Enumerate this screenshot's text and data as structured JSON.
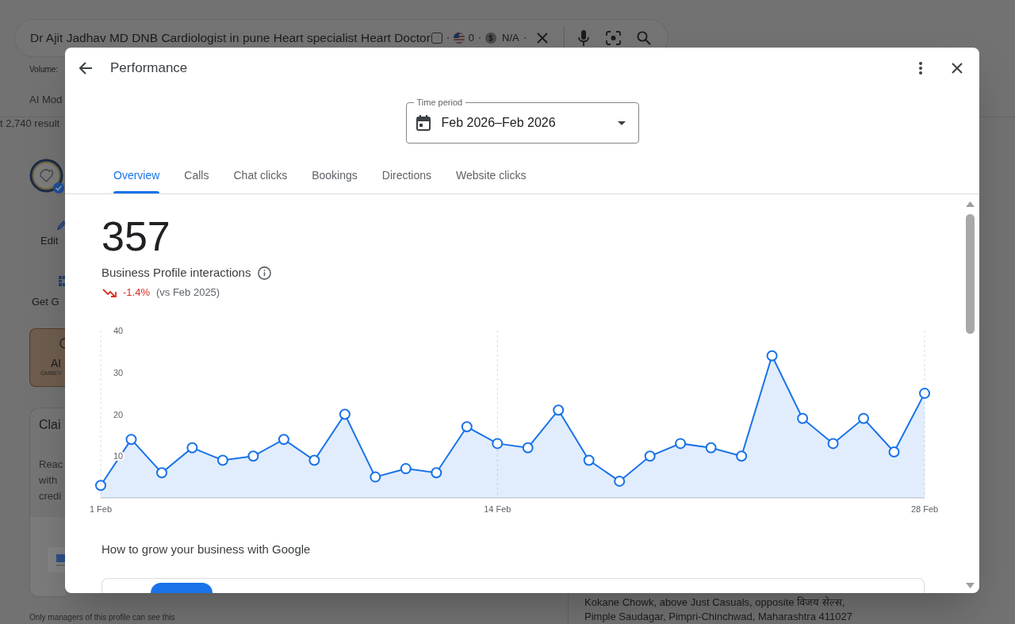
{
  "background_page": {
    "search_bar": {
      "query": "Dr Ajit Jadhav MD DNB Cardiologist in pune Heart specialist Heart Doctor",
      "checkbox": {
        "checked": false
      },
      "flag_count": "0",
      "cpc": "N/A"
    },
    "volume_label": "Volume:",
    "mode_tab": "AI Mod",
    "results_count": "t 2,740 result",
    "actions": [
      {
        "label": "Edit",
        "kind": "edit"
      },
      {
        "label": "Get G",
        "kind": "grid"
      }
    ],
    "promo_card": {
      "title": "AI",
      "subtitle": "GMBEV"
    },
    "claim_card": {
      "title": "Clai",
      "lines": [
        "Reac",
        "with",
        "credi"
      ]
    },
    "managers_note": "Only managers of this profile can see this",
    "address_lines": [
      "Kokane Chowk, above Just Casuals, opposite विजय सेल्स,",
      "Pimple Saudagar, Pimpri-Chinchwad, Maharashtra 411027"
    ]
  },
  "dialog": {
    "title": "Performance",
    "time_period": {
      "label": "Time period",
      "value": "Feb 2026–Feb 2026"
    },
    "tabs": [
      {
        "label": "Overview",
        "selected": true
      },
      {
        "label": "Calls",
        "selected": false
      },
      {
        "label": "Chat clicks",
        "selected": false
      },
      {
        "label": "Bookings",
        "selected": false
      },
      {
        "label": "Directions",
        "selected": false
      },
      {
        "label": "Website clicks",
        "selected": false
      }
    ],
    "total": "357",
    "metric_label": "Business Profile interactions",
    "change": {
      "negative": true,
      "value": "-1.4%",
      "comparison": "(vs Feb 2025)"
    },
    "chart": {
      "chart_data": {
        "type": "area",
        "categories": [
          "1 Feb",
          null,
          null,
          null,
          null,
          null,
          null,
          null,
          null,
          null,
          null,
          null,
          null,
          "14 Feb",
          null,
          null,
          null,
          null,
          null,
          null,
          null,
          null,
          null,
          null,
          null,
          null,
          null,
          "28 Feb"
        ],
        "ylim": [
          0,
          40
        ],
        "yticks": [
          10,
          20,
          30,
          40
        ],
        "series": [
          {
            "color": "#1a73e8",
            "values": [
              3,
              14,
              6,
              12,
              9,
              10,
              14,
              9,
              20,
              5,
              7,
              6,
              17,
              13,
              12,
              21,
              9,
              4,
              10,
              13,
              12,
              10,
              34,
              19,
              13,
              19,
              11,
              25
            ]
          }
        ]
      }
    },
    "section_title": "How to grow your business with Google"
  }
}
